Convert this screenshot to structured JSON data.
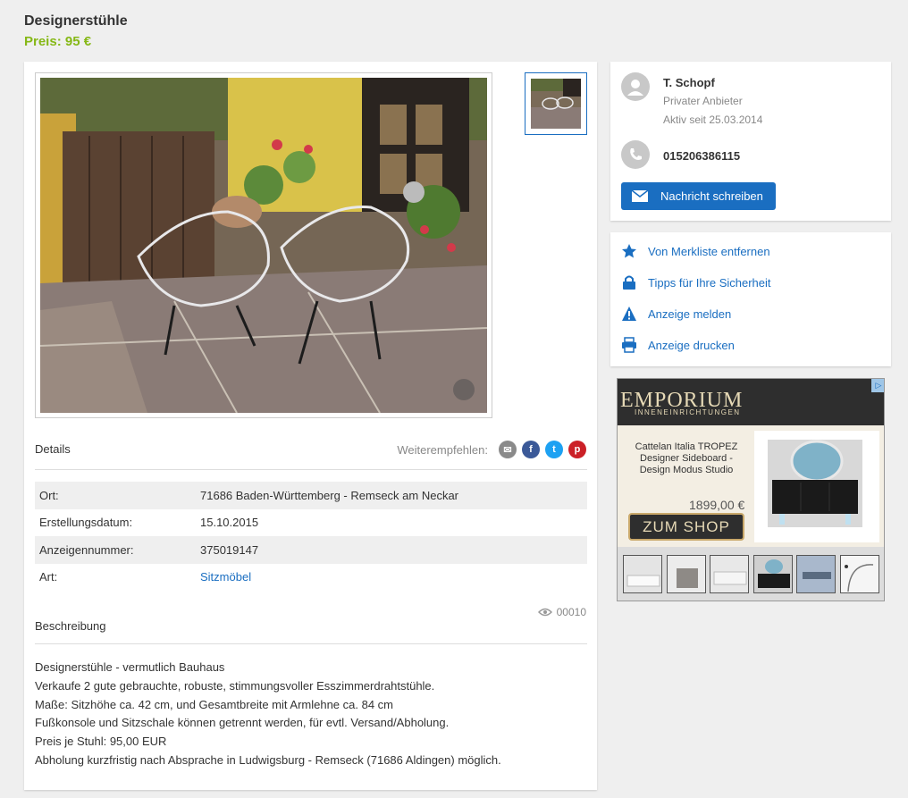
{
  "header": {
    "title": "Designerstühle",
    "price": "Preis: 95 €"
  },
  "details": {
    "heading": "Details",
    "share_label": "Weiterempfehlen:",
    "rows": [
      {
        "key": "Ort:",
        "value": "71686 Baden-Württemberg - Remseck am Neckar"
      },
      {
        "key": "Erstellungsdatum:",
        "value": "15.10.2015"
      },
      {
        "key": "Anzeigennummer:",
        "value": "375019147"
      },
      {
        "key": "Art:",
        "value": "Sitzmöbel"
      }
    ],
    "views": "00010"
  },
  "description": {
    "heading": "Beschreibung",
    "lines": [
      "Designerstühle - vermutlich Bauhaus",
      "Verkaufe 2 gute gebrauchte, robuste, stimmungsvoller Esszimmerdrahtstühle.",
      "Maße: Sitzhöhe ca. 42 cm, und Gesamtbreite mit Armlehne ca. 84 cm",
      "Fußkonsole und Sitzschale können getrennt werden, für evtl. Versand/Abholung.",
      "Preis je Stuhl: 95,00 EUR",
      "Abholung kurzfristig nach Absprache in Ludwigsburg - Remseck (71686 Aldingen) möglich."
    ]
  },
  "seller": {
    "name": "T. Schopf",
    "type": "Privater Anbieter",
    "since": "Aktiv seit 25.03.2014",
    "phone": "015206386115",
    "message_button": "Nachricht schreiben"
  },
  "actions": [
    {
      "label": "Von Merkliste entfernen",
      "icon": "star-icon"
    },
    {
      "label": "Tipps für Ihre Sicherheit",
      "icon": "lock-icon"
    },
    {
      "label": "Anzeige melden",
      "icon": "warning-icon"
    },
    {
      "label": "Anzeige drucken",
      "icon": "printer-icon"
    }
  ],
  "ad": {
    "brand": "EMPORIUM",
    "brand_sub": "INNENEINRICHTUNGEN",
    "product_text": "Cattelan Italia TROPEZ Designer Sideboard - Design Modus Studio",
    "price": "1899,00 €",
    "shop_button": "ZUM SHOP"
  },
  "colors": {
    "price_green": "#86b817",
    "link_blue": "#1a6ec1"
  }
}
